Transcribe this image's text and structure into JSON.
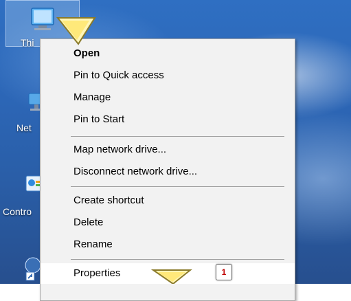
{
  "desktop": {
    "icons": [
      {
        "name": "this-pc",
        "label": "Thi"
      },
      {
        "name": "network",
        "label": "Net"
      },
      {
        "name": "control-panel",
        "label": "Contro"
      }
    ]
  },
  "context_menu": {
    "items": [
      {
        "label": "Open",
        "bold": true
      },
      {
        "label": "Pin to Quick access"
      },
      {
        "label": "Manage"
      },
      {
        "label": "Pin to Start"
      },
      {
        "label": "Map network drive..."
      },
      {
        "label": "Disconnect network drive..."
      },
      {
        "label": "Create shortcut"
      },
      {
        "label": "Delete"
      },
      {
        "label": "Rename"
      },
      {
        "label": "Properties"
      }
    ]
  },
  "step_badge": {
    "number": "1"
  }
}
